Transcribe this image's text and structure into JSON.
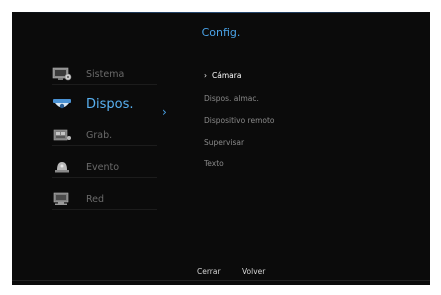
{
  "window": {
    "title": "Config."
  },
  "sidebar": {
    "items": [
      {
        "label": "Sistema",
        "icon": "system-icon",
        "active": false
      },
      {
        "label": "Dispos.",
        "icon": "camera-dome-icon",
        "active": true
      },
      {
        "label": "Grab.",
        "icon": "record-icon",
        "active": false
      },
      {
        "label": "Evento",
        "icon": "alarm-icon",
        "active": false
      },
      {
        "label": "Red",
        "icon": "network-icon",
        "active": false
      }
    ]
  },
  "submenu": {
    "items": [
      {
        "label": "Cámara",
        "active": true
      },
      {
        "label": "Dispos. almac.",
        "active": false
      },
      {
        "label": "Dispositivo remoto",
        "active": false
      },
      {
        "label": "Supervisar",
        "active": false
      },
      {
        "label": "Texto",
        "active": false
      }
    ]
  },
  "footer": {
    "close_label": "Cerrar",
    "back_label": "Volver"
  },
  "colors": {
    "accent": "#4aa3e8",
    "background": "#0b0b0b",
    "text_muted": "#6a6a6a"
  }
}
